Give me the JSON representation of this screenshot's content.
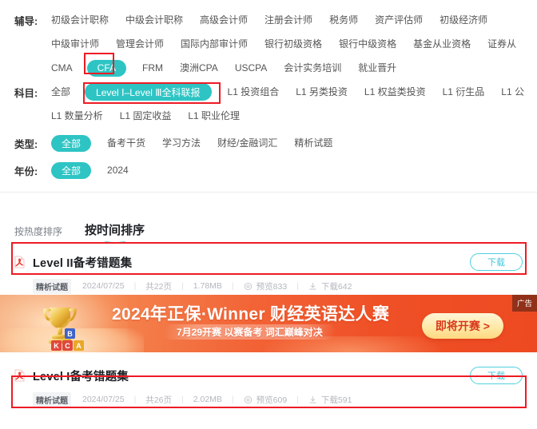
{
  "filters": [
    {
      "id": "tutoring",
      "label": "辅导:",
      "rows": [
        [
          "初级会计职称",
          "中级会计职称",
          "高级会计师",
          "注册会计师",
          "税务师",
          "资产评估师",
          "初级经济师"
        ],
        [
          "中级审计师",
          "管理会计师",
          "国际内部审计师",
          "银行初级资格",
          "银行中级资格",
          "基金从业资格",
          "证券从"
        ],
        [
          "CMA",
          "CFA",
          "FRM",
          "澳洲CPA",
          "USCPA",
          "会计实务培训",
          "就业晋升"
        ]
      ],
      "selected": "CFA"
    },
    {
      "id": "subject",
      "label": "科目:",
      "rows": [
        [
          "全部",
          "Level Ⅰ–Level Ⅲ全科联报",
          "L1 投资组合",
          "L1 另类投资",
          "L1 权益类投资",
          "L1 衍生品",
          "L1 公"
        ],
        [
          "L1 数量分析",
          "L1 固定收益",
          "L1 职业伦理"
        ]
      ],
      "selected": "Level Ⅰ–Level Ⅲ全科联报"
    },
    {
      "id": "type",
      "label": "类型:",
      "rows": [
        [
          "全部",
          "备考干货",
          "学习方法",
          "财经/金融词汇",
          "精析试题"
        ]
      ],
      "selected": "全部"
    },
    {
      "id": "year",
      "label": "年份:",
      "rows": [
        [
          "全部",
          "2024"
        ]
      ],
      "selected": "全部"
    }
  ],
  "sort": {
    "options": [
      {
        "label": "按热度排序",
        "active": false
      },
      {
        "label": "按时间排序",
        "active": true
      }
    ]
  },
  "results": [
    {
      "icon": "pdf-icon",
      "title": "Level II备考错题集",
      "download_label": "下载",
      "tag": "精析试题",
      "date": "2024/07/25",
      "pages": "共22页",
      "size": "1.78MB",
      "preview_label": "预览833",
      "download_count_label": "下载642"
    },
    {
      "icon": "pdf-icon",
      "title": "Level I备考错题集",
      "download_label": "下载",
      "tag": "精析试题",
      "date": "2024/07/25",
      "pages": "共26页",
      "size": "2.02MB",
      "preview_label": "预览609",
      "download_count_label": "下载591"
    }
  ],
  "ad": {
    "title": "2024年正保·Winner 财经英语达人赛",
    "subtitle": "7月29开赛 以赛备考 词汇巅峰对决",
    "cta": "即将开赛 >",
    "flag": "广告",
    "cubes": [
      {
        "letter": "B",
        "color": "#3f63c8"
      },
      {
        "letter": "K",
        "color": "#e0483c"
      },
      {
        "letter": "C",
        "color": "#e0483c"
      },
      {
        "letter": "A",
        "color": "#e8a828"
      }
    ]
  },
  "colors": {
    "accent": "#2ec4c4",
    "annotation": "#ee1b24",
    "download_border": "#4fd0e0",
    "pdf_red": "#e8413c"
  }
}
